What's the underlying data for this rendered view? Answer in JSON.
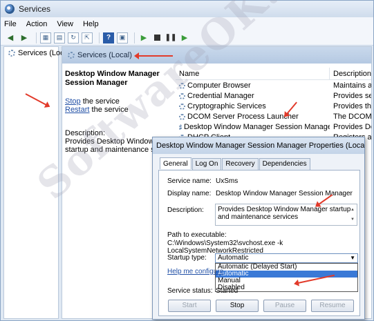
{
  "window": {
    "title": "Services"
  },
  "menu": [
    "File",
    "Action",
    "View",
    "Help"
  ],
  "tree": {
    "item": "Services (Local"
  },
  "main": {
    "header": "Services (Local)",
    "selected_service_title": "Desktop Window Manager Session Manager",
    "actions": {
      "stop": "Stop",
      "stop_suffix": " the service",
      "restart": "Restart",
      "restart_suffix": " the service"
    },
    "description_label": "Description:",
    "description_text": "Provides Desktop Window Ma startup and maintenance serv"
  },
  "list": {
    "columns": {
      "name": "Name",
      "description": "Description"
    },
    "rows": [
      {
        "name": "Computer Browser",
        "desc": "Maintains a"
      },
      {
        "name": "Credential Manager",
        "desc": "Provides se"
      },
      {
        "name": "Cryptographic Services",
        "desc": "Provides th"
      },
      {
        "name": "DCOM Server Process Launcher",
        "desc": "The DCOM"
      },
      {
        "name": "Desktop Window Manager Session Manager",
        "desc": "Provides De"
      },
      {
        "name": "DHCP Client",
        "desc": "Registers an"
      }
    ]
  },
  "dialog": {
    "title": "Desktop Window Manager Session Manager Properties (Local Co...",
    "tabs": [
      "General",
      "Log On",
      "Recovery",
      "Dependencies"
    ],
    "service_name_label": "Service name:",
    "service_name_value": "UxSms",
    "display_name_label": "Display name:",
    "display_name_value": "Desktop Window Manager Session Manager",
    "description_label": "Description:",
    "description_value": "Provides Desktop Window Manager startup and maintenance services",
    "path_label": "Path to executable:",
    "path_value": "C:\\Windows\\System32\\svchost.exe -k LocalSystemNetworkRestricted",
    "startup_label": "Startup type:",
    "startup_value": "Automatic",
    "startup_options": [
      "Automatic (Delayed Start)",
      "Automatic",
      "Manual",
      "Disabled"
    ],
    "startup_selected_index": 1,
    "help_link": "Help me configure",
    "status_label": "Service status:",
    "status_value": "Started",
    "buttons": {
      "start": "Start",
      "stop": "Stop",
      "pause": "Pause",
      "resume": "Resume"
    }
  },
  "watermark": "SoftwareOK.com",
  "colors": {
    "annotation_arrow": "#e23a2a",
    "link": "#1f4ea5",
    "selection": "#3a79d6"
  }
}
